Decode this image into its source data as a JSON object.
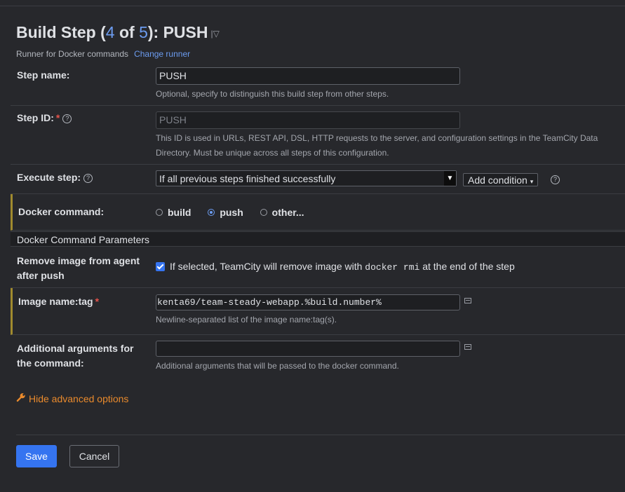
{
  "header": {
    "title_prefix": "Build Step (",
    "step_current": "4",
    "title_of": " of ",
    "step_total": "5",
    "title_suffix": "): PUSH",
    "caret": "|▽",
    "runner_text": "Runner for Docker commands",
    "change_runner": "Change runner"
  },
  "step_name": {
    "label": "Step name:",
    "value": "PUSH",
    "hint": "Optional, specify to distinguish this build step from other steps."
  },
  "step_id": {
    "label": "Step ID:",
    "required": "*",
    "help": "?",
    "placeholder": "PUSH",
    "hint_line1": "This ID is used in URLs, REST API, DSL, HTTP requests to the server, and configuration settings in the TeamCity Data",
    "hint_line2": "Directory. Must be unique across all steps of this configuration."
  },
  "execute_step": {
    "label": "Execute step:",
    "help": "?",
    "selected": "If all previous steps finished successfully",
    "add_condition": "Add condition",
    "help2": "?"
  },
  "docker_command": {
    "label": "Docker command:",
    "options": [
      {
        "label": "build",
        "checked": false
      },
      {
        "label": "push",
        "checked": true
      },
      {
        "label": "other...",
        "checked": false
      }
    ]
  },
  "section": {
    "title": "Docker Command Parameters"
  },
  "remove_image": {
    "label_line1": "Remove image from agent",
    "label_line2": "after push",
    "text_before": "If selected, TeamCity will remove image with ",
    "code": "docker rmi",
    "text_after": " at the end of the step",
    "checked": true
  },
  "image_tag": {
    "label": "Image name:tag",
    "required": "*",
    "value": "kenta69/team-steady-webapp.%build.number%",
    "hint": "Newline-separated list of the image name:tag(s)."
  },
  "additional_args": {
    "label_line1": "Additional arguments for",
    "label_line2": "the command:",
    "value": "",
    "hint": "Additional arguments that will be passed to the docker command."
  },
  "advanced": {
    "label": "Hide advanced options"
  },
  "footer": {
    "save": "Save",
    "cancel": "Cancel"
  },
  "colors": {
    "background": "#27282c",
    "accent": "#3574f0",
    "link": "#6c9cf0",
    "warning_link": "#e98a2c",
    "highlight_bar": "#a08a2e"
  }
}
